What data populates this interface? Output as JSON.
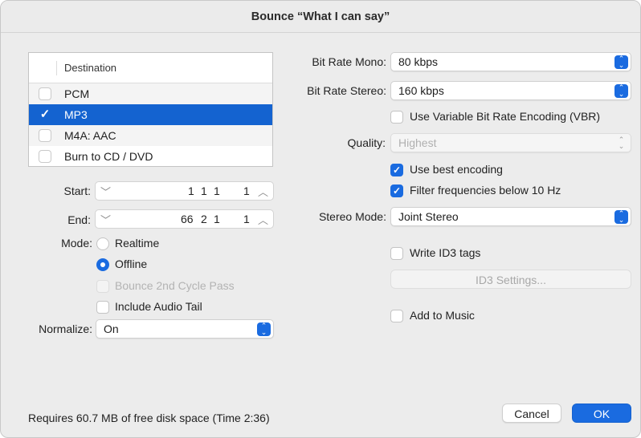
{
  "window": {
    "title": "Bounce “What I can say”"
  },
  "destination": {
    "header": "Destination",
    "items": [
      {
        "label": "PCM",
        "checked": false
      },
      {
        "label": "MP3",
        "checked": true
      },
      {
        "label": "M4A: AAC",
        "checked": false
      },
      {
        "label": "Burn to CD / DVD",
        "checked": false
      }
    ]
  },
  "start": {
    "label": "Start:",
    "bar": "1",
    "beat": "1",
    "division": "1",
    "tick": "1"
  },
  "end": {
    "label": "End:",
    "bar": "66",
    "beat": "2",
    "division": "1",
    "tick": "1"
  },
  "mode": {
    "label": "Mode:",
    "options": [
      "Realtime",
      "Offline"
    ],
    "selected": "Offline"
  },
  "bounce_2nd_cycle": {
    "label": "Bounce 2nd Cycle Pass",
    "checked": false,
    "enabled": false
  },
  "include_audio_tail": {
    "label": "Include Audio Tail",
    "checked": false
  },
  "normalize": {
    "label": "Normalize:",
    "value": "On"
  },
  "bit_rate_mono": {
    "label": "Bit Rate Mono:",
    "value": "80 kbps"
  },
  "bit_rate_stereo": {
    "label": "Bit Rate Stereo:",
    "value": "160 kbps"
  },
  "vbr": {
    "label": "Use Variable Bit Rate Encoding (VBR)",
    "checked": false
  },
  "quality": {
    "label": "Quality:",
    "value": "Highest",
    "enabled": false
  },
  "best_encoding": {
    "label": "Use best encoding",
    "checked": true
  },
  "filter_freq": {
    "label": "Filter frequencies below 10 Hz",
    "checked": true
  },
  "stereo_mode": {
    "label": "Stereo Mode:",
    "value": "Joint Stereo"
  },
  "id3_tags": {
    "label": "Write ID3 tags",
    "checked": false
  },
  "id3_settings": {
    "label": "ID3 Settings...",
    "enabled": false
  },
  "add_to_music": {
    "label": "Add to Music",
    "checked": false
  },
  "footer": {
    "status": "Requires 60.7 MB of free disk space  (Time 2:36)",
    "cancel_label": "Cancel",
    "ok_label": "OK"
  },
  "colors": {
    "accent": "#1a6be0",
    "selection": "#1463d0"
  },
  "icons": {
    "check": "checkmark-icon",
    "popup": "chevron-updown-icon",
    "stepper_down": "chevron-down-icon",
    "stepper_up": "chevron-up-icon"
  }
}
